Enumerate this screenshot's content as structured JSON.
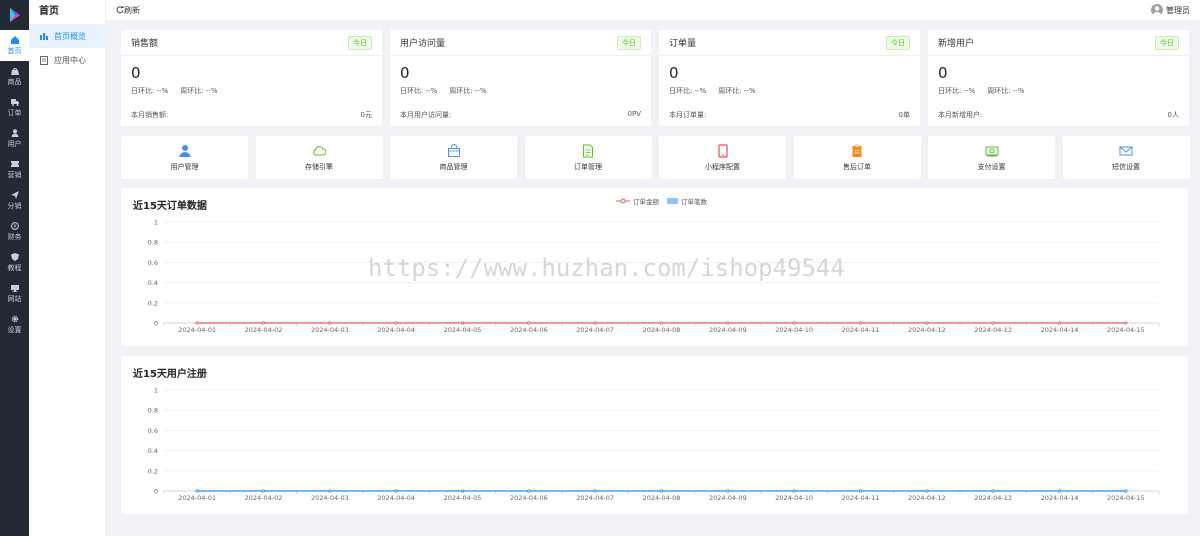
{
  "nav": [
    {
      "label": "首页",
      "icon": "home-icon",
      "active": true
    },
    {
      "label": "商品",
      "icon": "bag-icon"
    },
    {
      "label": "订单",
      "icon": "truck-icon"
    },
    {
      "label": "用户",
      "icon": "user-icon"
    },
    {
      "label": "营销",
      "icon": "ticket-icon"
    },
    {
      "label": "分销",
      "icon": "send-icon"
    },
    {
      "label": "财务",
      "icon": "finance-icon"
    },
    {
      "label": "教程",
      "icon": "shield-icon"
    },
    {
      "label": "网站",
      "icon": "globe-icon"
    },
    {
      "label": "设置",
      "icon": "gear-icon"
    }
  ],
  "subnav": {
    "title": "首页",
    "items": [
      {
        "label": "首页概览",
        "icon": "bar-chart-icon",
        "active": true
      },
      {
        "label": "应用中心",
        "icon": "doc-icon"
      }
    ]
  },
  "topbar": {
    "refresh": "刷新",
    "user": "管理员"
  },
  "cards": [
    {
      "title": "销售额",
      "badge": "今日",
      "value": "0",
      "day": "日环比: --%",
      "week": "周环比: --%",
      "footLabel": "本月销售额:",
      "footValue": "0元"
    },
    {
      "title": "用户访问量",
      "badge": "今日",
      "value": "0",
      "day": "日环比: --%",
      "week": "周环比: --%",
      "footLabel": "本月用户访问量:",
      "footValue": "0PV"
    },
    {
      "title": "订单量",
      "badge": "今日",
      "value": "0",
      "day": "日环比: --%",
      "week": "周环比: --%",
      "footLabel": "本月订单量:",
      "footValue": "0单"
    },
    {
      "title": "新增用户",
      "badge": "今日",
      "value": "0",
      "day": "日环比: --%",
      "week": "周环比: --%",
      "footLabel": "本月新增用户:",
      "footValue": "0人"
    }
  ],
  "tiles": [
    {
      "label": "用户管理",
      "icon": "user-manage-icon",
      "color": "#4a90e2"
    },
    {
      "label": "存储引擎",
      "icon": "cloud-icon",
      "color": "#52c41a"
    },
    {
      "label": "商品管理",
      "icon": "shopping-bag-icon",
      "color": "#4a90e2"
    },
    {
      "label": "订单管理",
      "icon": "order-doc-icon",
      "color": "#52c41a"
    },
    {
      "label": "小程序配置",
      "icon": "mobile-icon",
      "color": "#f5222d"
    },
    {
      "label": "售后订单",
      "icon": "clipboard-icon",
      "color": "#fa8c16"
    },
    {
      "label": "支付设置",
      "icon": "money-icon",
      "color": "#52c41a"
    },
    {
      "label": "短信设置",
      "icon": "mail-icon",
      "color": "#4a90e2"
    }
  ],
  "watermark": "https://www.huzhan.com/ishop49544",
  "chart_data": [
    {
      "type": "line",
      "title": "近15天订单数据",
      "categories": [
        "2024-04-01",
        "2024-04-02",
        "2024-04-03",
        "2024-04-04",
        "2024-04-05",
        "2024-04-06",
        "2024-04-07",
        "2024-04-08",
        "2024-04-09",
        "2024-04-10",
        "2024-04-11",
        "2024-04-12",
        "2024-04-13",
        "2024-04-14",
        "2024-04-15"
      ],
      "series": [
        {
          "name": "订单金额",
          "kind": "line",
          "color": "#e05a5a",
          "values": [
            0,
            0,
            0,
            0,
            0,
            0,
            0,
            0,
            0,
            0,
            0,
            0,
            0,
            0,
            0
          ]
        },
        {
          "name": "订单笔数",
          "kind": "bar",
          "color": "#8ec5f5",
          "values": [
            0,
            0,
            0,
            0,
            0,
            0,
            0,
            0,
            0,
            0,
            0,
            0,
            0,
            0,
            0
          ]
        }
      ],
      "yticks": [
        "0",
        "0.2",
        "0.4",
        "0.6",
        "0.8",
        "1"
      ],
      "ylim": [
        0,
        1
      ],
      "legend": "top-center",
      "grid": true
    },
    {
      "type": "line",
      "title": "近15天用户注册",
      "categories": [
        "2024-04-01",
        "2024-04-02",
        "2024-04-03",
        "2024-04-04",
        "2024-04-05",
        "2024-04-06",
        "2024-04-07",
        "2024-04-08",
        "2024-04-09",
        "2024-04-10",
        "2024-04-11",
        "2024-04-12",
        "2024-04-13",
        "2024-04-14",
        "2024-04-15"
      ],
      "series": [
        {
          "kind": "line",
          "color": "#1890ff",
          "values": [
            0,
            0,
            0,
            0,
            0,
            0,
            0,
            0,
            0,
            0,
            0,
            0,
            0,
            0,
            0
          ]
        }
      ],
      "yticks": [
        "0",
        "0.2",
        "0.4",
        "0.6",
        "0.8",
        "1"
      ],
      "ylim": [
        0,
        1
      ],
      "grid": true
    }
  ]
}
